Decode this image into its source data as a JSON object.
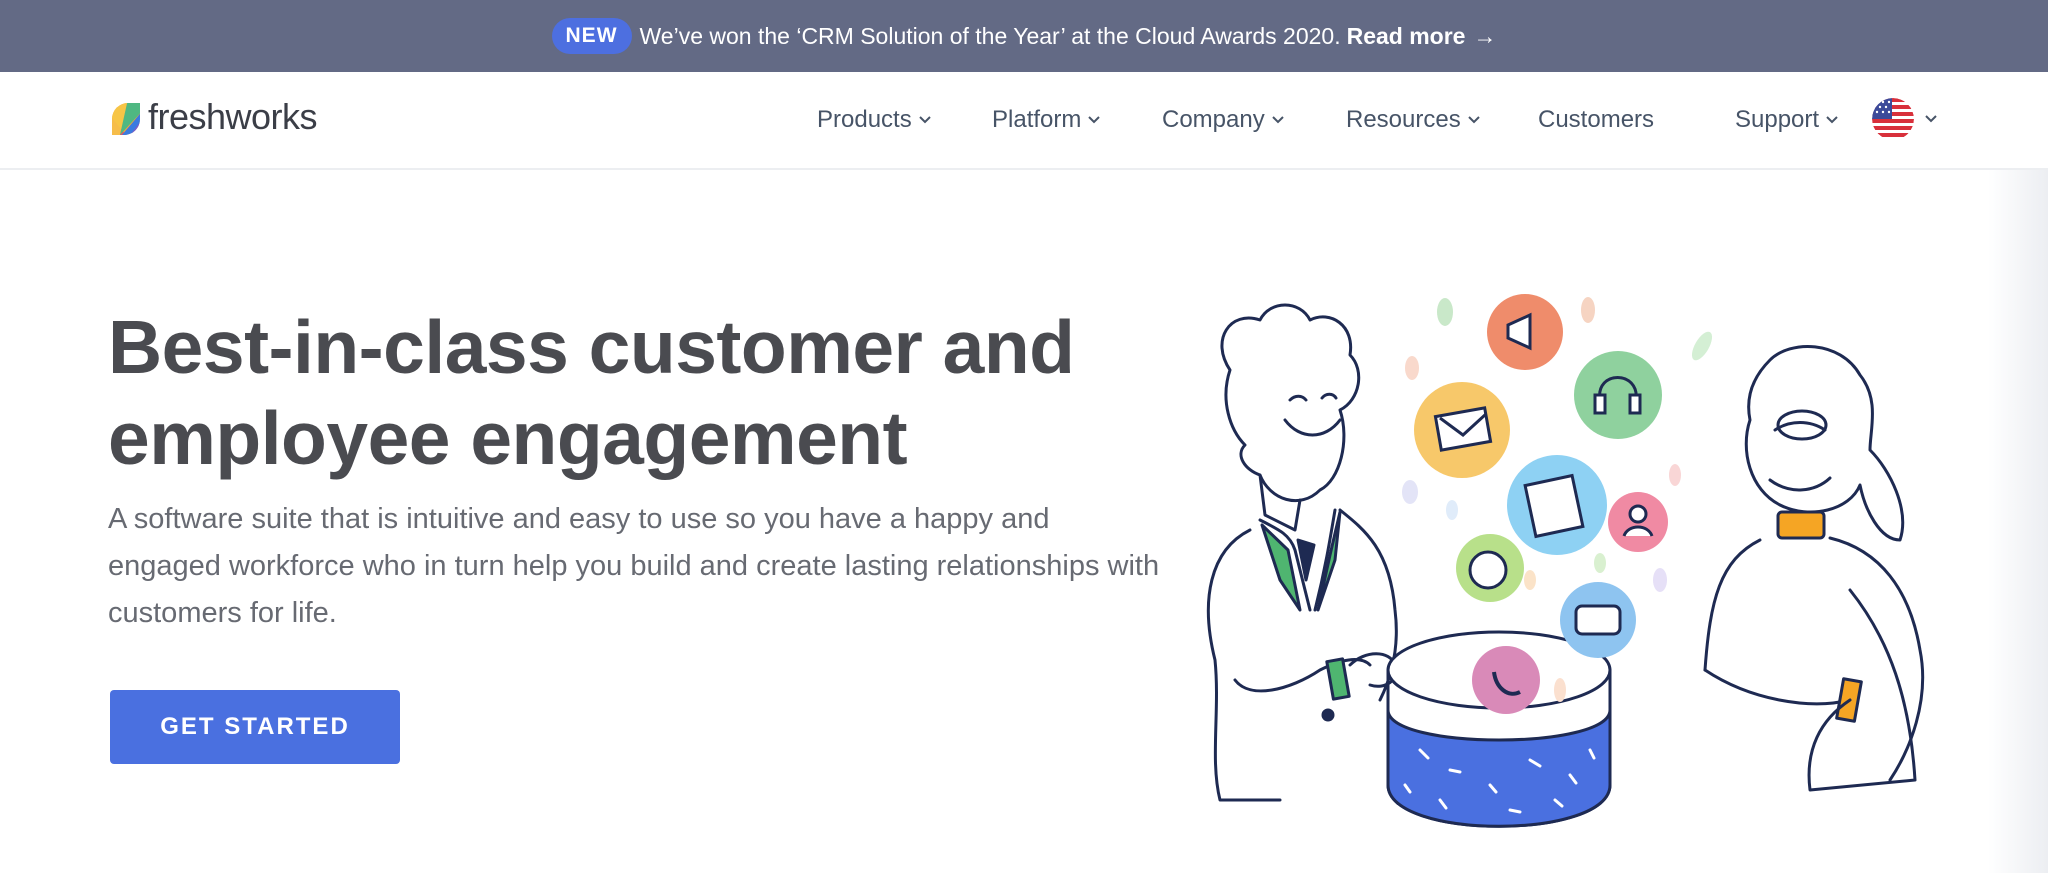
{
  "announcement": {
    "badge": "NEW",
    "text": "We’ve won the ‘CRM Solution of the Year’ at the Cloud Awards 2020.",
    "link": "Read more",
    "link_icon": "arrow-right-icon"
  },
  "header": {
    "logo_text": "freshworks",
    "nav": [
      {
        "label": "Products",
        "has_dropdown": true
      },
      {
        "label": "Platform",
        "has_dropdown": true
      },
      {
        "label": "Company",
        "has_dropdown": true
      },
      {
        "label": "Resources",
        "has_dropdown": true
      },
      {
        "label": "Customers",
        "has_dropdown": false
      },
      {
        "label": "Support",
        "has_dropdown": true
      }
    ],
    "locale_icon": "us-flag-icon"
  },
  "hero": {
    "title_line1": "Best-in-class customer and",
    "title_line2": "employee engagement",
    "subtitle": "A software suite that is intuitive and easy to use so you have a happy and engaged workforce who in turn help you build and create lasting relationships with customers for life.",
    "cta_label": "GET STARTED"
  },
  "colors": {
    "announce_bg": "#636a85",
    "badge_bg": "#4d6fe0",
    "cta_bg": "#4a70e0",
    "title": "#4a4b50",
    "text": "#676a72"
  }
}
